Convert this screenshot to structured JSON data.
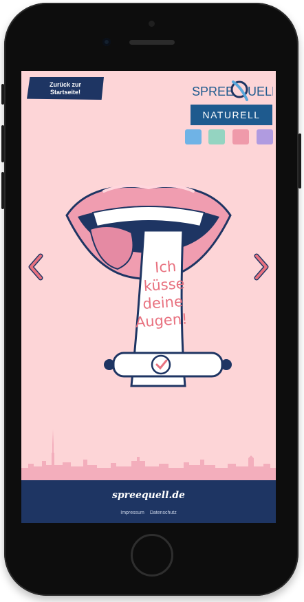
{
  "header": {
    "back_button_line1": "Zurück zur",
    "back_button_line2": "Startseite!",
    "logo_left": "SPREE",
    "logo_right": "UELL",
    "variant_label": "NATURELL"
  },
  "swatches": [
    {
      "color": "#6fb3e6"
    },
    {
      "color": "#94d4c1"
    },
    {
      "color": "#ef9aaa"
    },
    {
      "color": "#b09be0"
    }
  ],
  "navigation": {
    "prev_icon": "chevron-left-icon",
    "next_icon": "chevron-right-icon"
  },
  "illustration": {
    "line1": "Ich",
    "line2": "küsse",
    "line3": "deine",
    "line4": "Augen!"
  },
  "footer": {
    "logo_text": "spreequell.de",
    "links": [
      "Impressum",
      "Datenschutz"
    ]
  },
  "colors": {
    "background": "#fdd5d7",
    "navy": "#1e3563",
    "variant_blue": "#1e5a8e",
    "accent_pink": "#e8717f"
  }
}
